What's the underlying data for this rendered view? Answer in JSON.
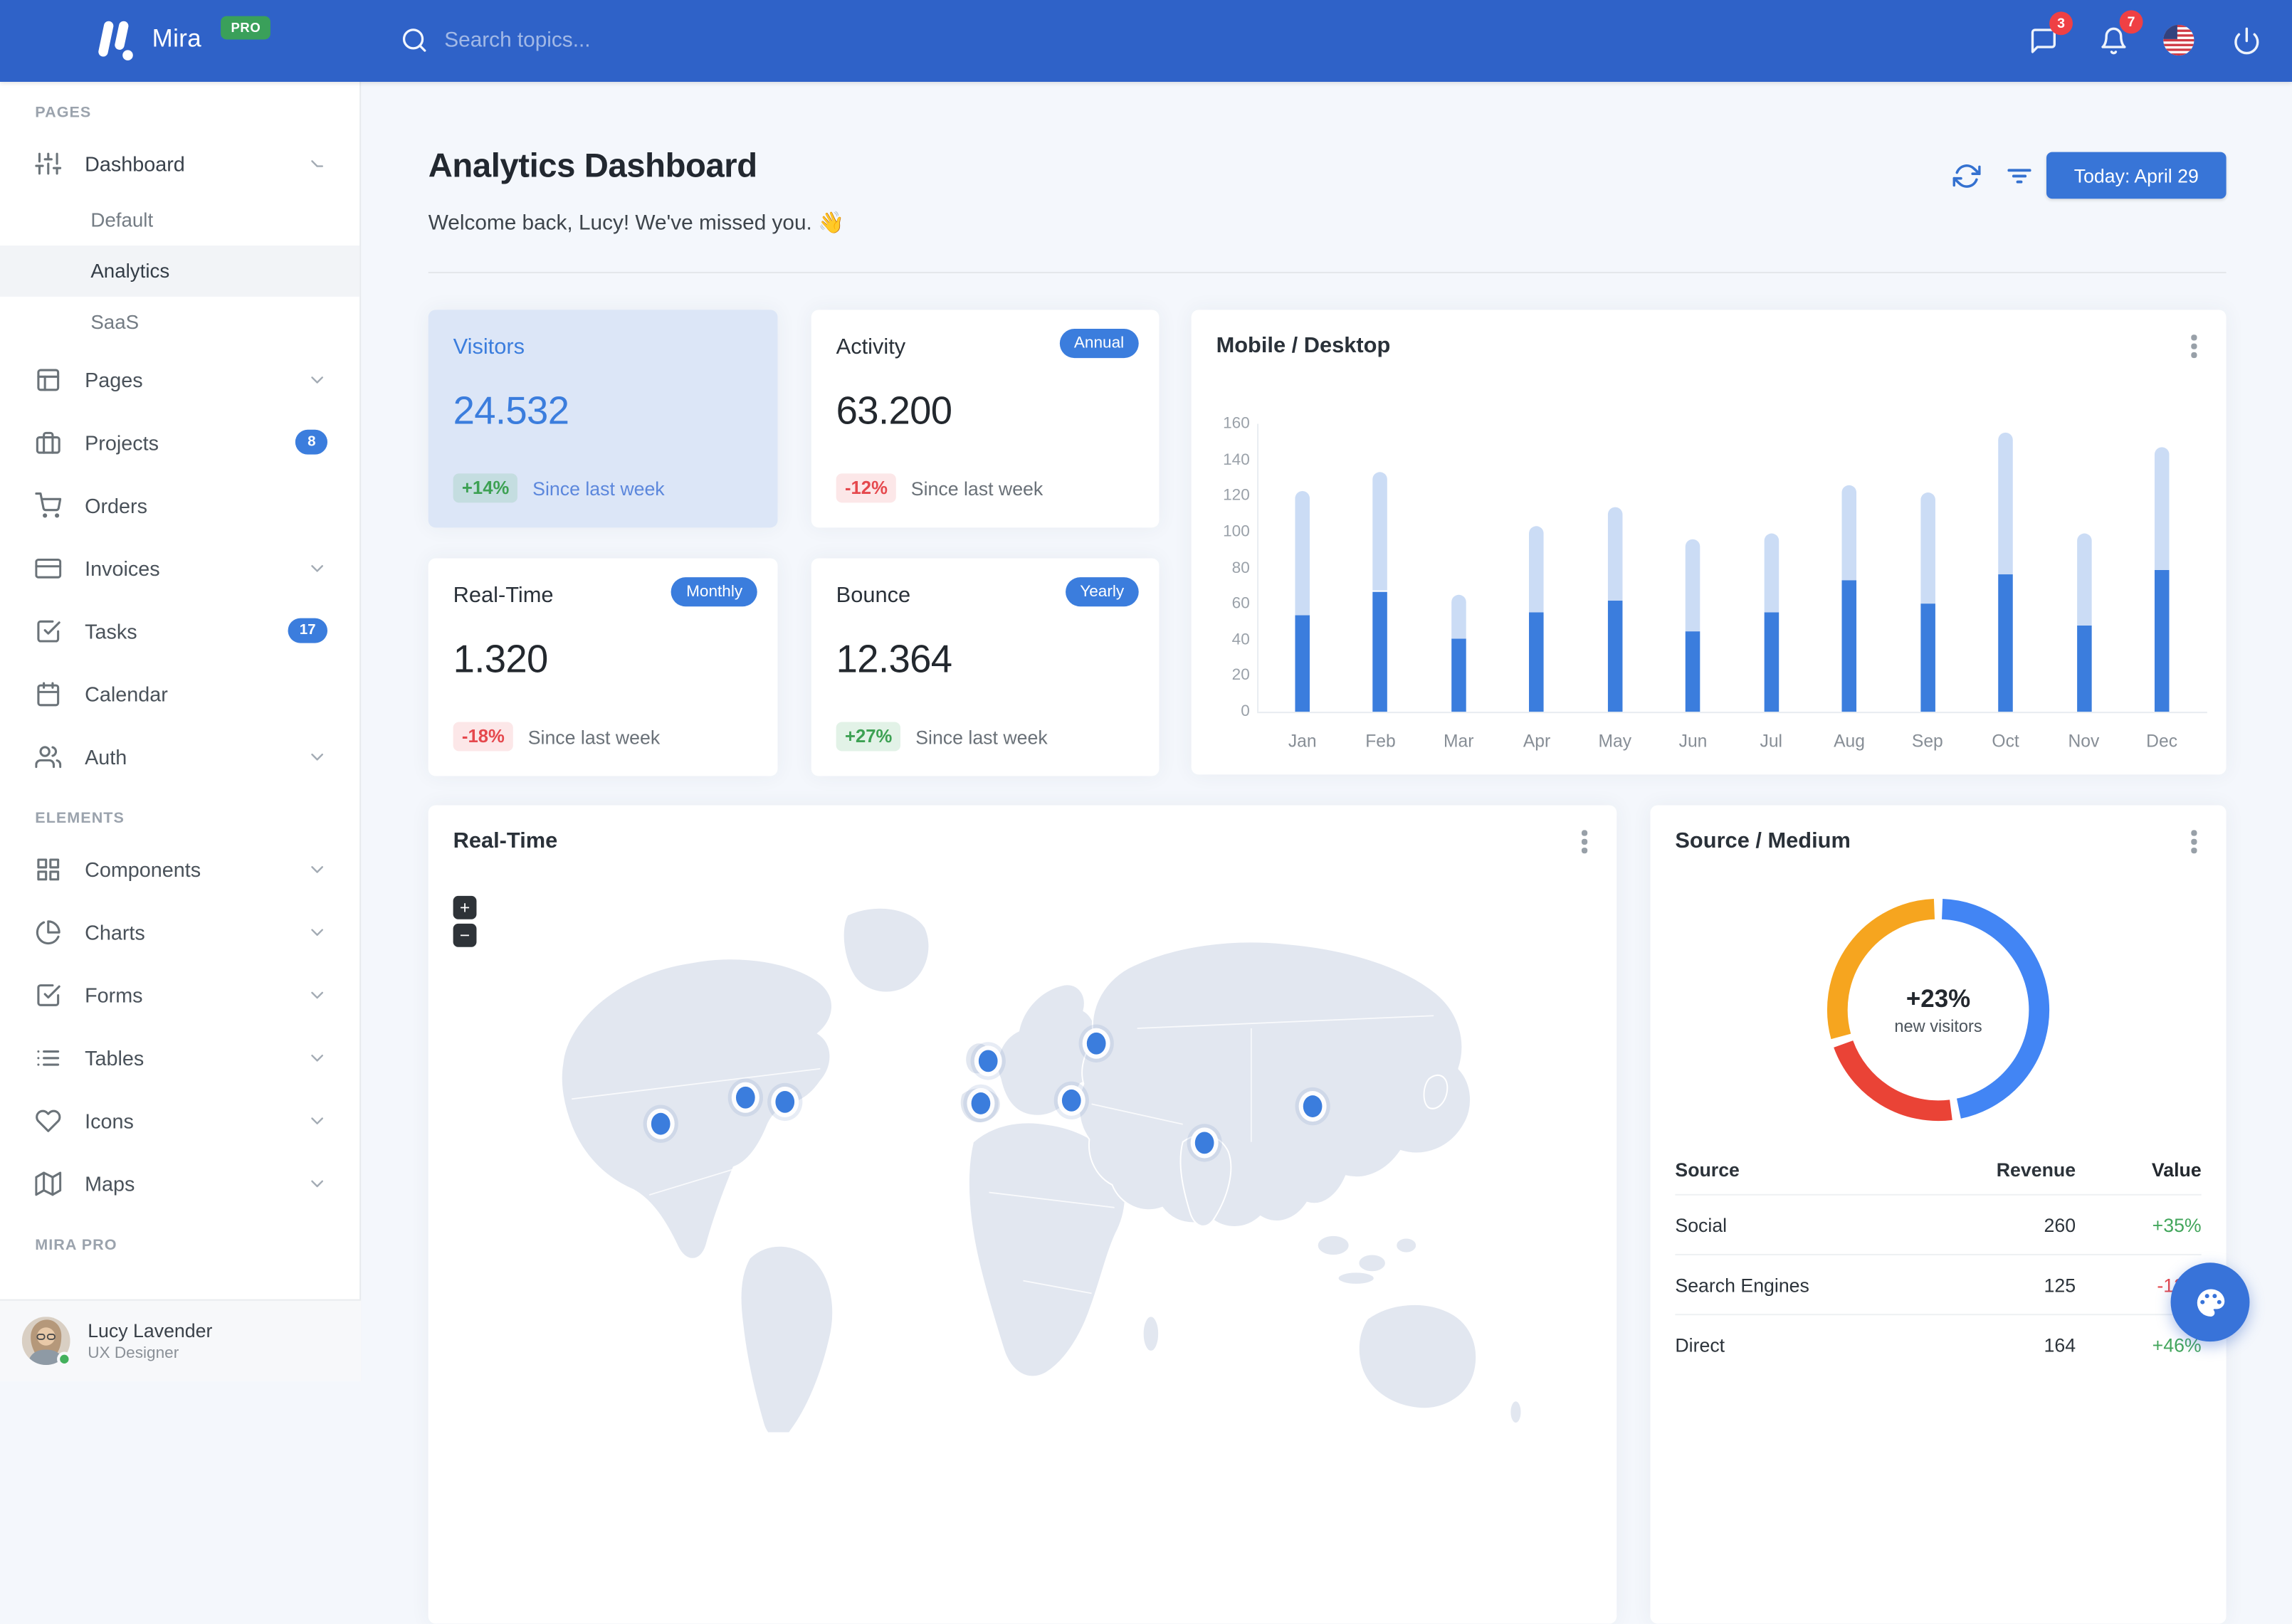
{
  "navbar": {
    "brand": "Mira",
    "pro_badge": "PRO",
    "search_placeholder": "Search topics...",
    "messages_badge": "3",
    "notifications_badge": "7"
  },
  "sidebar": {
    "sections": [
      {
        "label": "PAGES",
        "items": [
          {
            "label": "Dashboard",
            "icon": "sliders",
            "expanded": true,
            "children": [
              {
                "label": "Default",
                "active": false
              },
              {
                "label": "Analytics",
                "active": true
              },
              {
                "label": "SaaS",
                "active": false
              }
            ]
          },
          {
            "label": "Pages",
            "icon": "layout",
            "chevron": "down"
          },
          {
            "label": "Projects",
            "icon": "briefcase",
            "badge": "8"
          },
          {
            "label": "Orders",
            "icon": "cart"
          },
          {
            "label": "Invoices",
            "icon": "credit-card",
            "chevron": "down"
          },
          {
            "label": "Tasks",
            "icon": "check-square",
            "badge": "17"
          },
          {
            "label": "Calendar",
            "icon": "calendar"
          },
          {
            "label": "Auth",
            "icon": "users",
            "chevron": "down"
          }
        ]
      },
      {
        "label": "ELEMENTS",
        "items": [
          {
            "label": "Components",
            "icon": "grid",
            "chevron": "down"
          },
          {
            "label": "Charts",
            "icon": "pie-chart",
            "chevron": "down"
          },
          {
            "label": "Forms",
            "icon": "check-square",
            "chevron": "down"
          },
          {
            "label": "Tables",
            "icon": "list",
            "chevron": "down"
          },
          {
            "label": "Icons",
            "icon": "heart",
            "chevron": "down"
          },
          {
            "label": "Maps",
            "icon": "map",
            "chevron": "down"
          }
        ]
      },
      {
        "label": "MIRA PRO",
        "items": []
      }
    ]
  },
  "user": {
    "name": "Lucy Lavender",
    "role": "UX Designer"
  },
  "header": {
    "title": "Analytics Dashboard",
    "welcome": "Welcome back, Lucy! We've missed you. 👋",
    "today_button": "Today: April 29"
  },
  "stats": [
    {
      "title": "Visitors",
      "value": "24.532",
      "badge": "",
      "delta": "+14%",
      "note": "Since last week",
      "variant": "primary"
    },
    {
      "title": "Activity",
      "value": "63.200",
      "badge": "Annual",
      "delta": "-12%",
      "note": "Since last week",
      "variant": "default"
    },
    {
      "title": "Real-Time",
      "value": "1.320",
      "badge": "Monthly",
      "delta": "-18%",
      "note": "Since last week",
      "variant": "default"
    },
    {
      "title": "Bounce",
      "value": "12.364",
      "badge": "Yearly",
      "delta": "+27%",
      "note": "Since last week",
      "variant": "default"
    }
  ],
  "chart_data": [
    {
      "id": "mobile-desktop",
      "type": "bar",
      "title": "Mobile / Desktop",
      "stacked": true,
      "categories": [
        "Jan",
        "Feb",
        "Mar",
        "Apr",
        "May",
        "Jun",
        "Jul",
        "Aug",
        "Sep",
        "Oct",
        "Nov",
        "Dec"
      ],
      "series": [
        {
          "name": "Mobile",
          "color": "#3b7ddd",
          "values": [
            54,
            67,
            41,
            55,
            62,
            45,
            55,
            73,
            60,
            76,
            48,
            79
          ]
        },
        {
          "name": "Desktop",
          "color": "#cbdcf5",
          "values": [
            69,
            66,
            24,
            48,
            52,
            51,
            44,
            53,
            62,
            79,
            51,
            68
          ]
        }
      ],
      "ylabel": "",
      "xlabel": "",
      "ylim": [
        0,
        160
      ],
      "ytick_step": 20,
      "grid": false,
      "legend": "none"
    },
    {
      "id": "source-medium-donut",
      "type": "pie",
      "donut": true,
      "title": "Source / Medium",
      "labels": [
        "Social",
        "Search Engines",
        "Direct"
      ],
      "values": [
        260,
        125,
        164
      ],
      "colors": [
        "#4285f4",
        "#ea4336",
        "#f6a51f"
      ],
      "center_label": "+23%",
      "center_sublabel": "new visitors",
      "legend": "none"
    }
  ],
  "map": {
    "title": "Real-Time",
    "zoom_in": "+",
    "zoom_out": "−",
    "markers": [
      {
        "name": "San Francisco",
        "x": 18.2,
        "y": 44.4
      },
      {
        "name": "Chicago",
        "x": 25.6,
        "y": 39.7
      },
      {
        "name": "New York",
        "x": 29.1,
        "y": 40.6
      },
      {
        "name": "London",
        "x": 46.9,
        "y": 33.2
      },
      {
        "name": "Madrid",
        "x": 46.3,
        "y": 40.9
      },
      {
        "name": "Moscow",
        "x": 56.4,
        "y": 30.0
      },
      {
        "name": "Ankara",
        "x": 54.2,
        "y": 40.3
      },
      {
        "name": "New Delhi",
        "x": 65.9,
        "y": 47.9
      },
      {
        "name": "Beijing",
        "x": 75.4,
        "y": 41.2
      }
    ]
  },
  "source_medium": {
    "title": "Source / Medium",
    "table": {
      "headers": [
        "Source",
        "Revenue",
        "Value"
      ],
      "rows": [
        {
          "source": "Social",
          "revenue": "260",
          "value": "+35%"
        },
        {
          "source": "Search Engines",
          "revenue": "125",
          "value": "-12%"
        },
        {
          "source": "Direct",
          "revenue": "164",
          "value": "+46%"
        }
      ]
    }
  }
}
